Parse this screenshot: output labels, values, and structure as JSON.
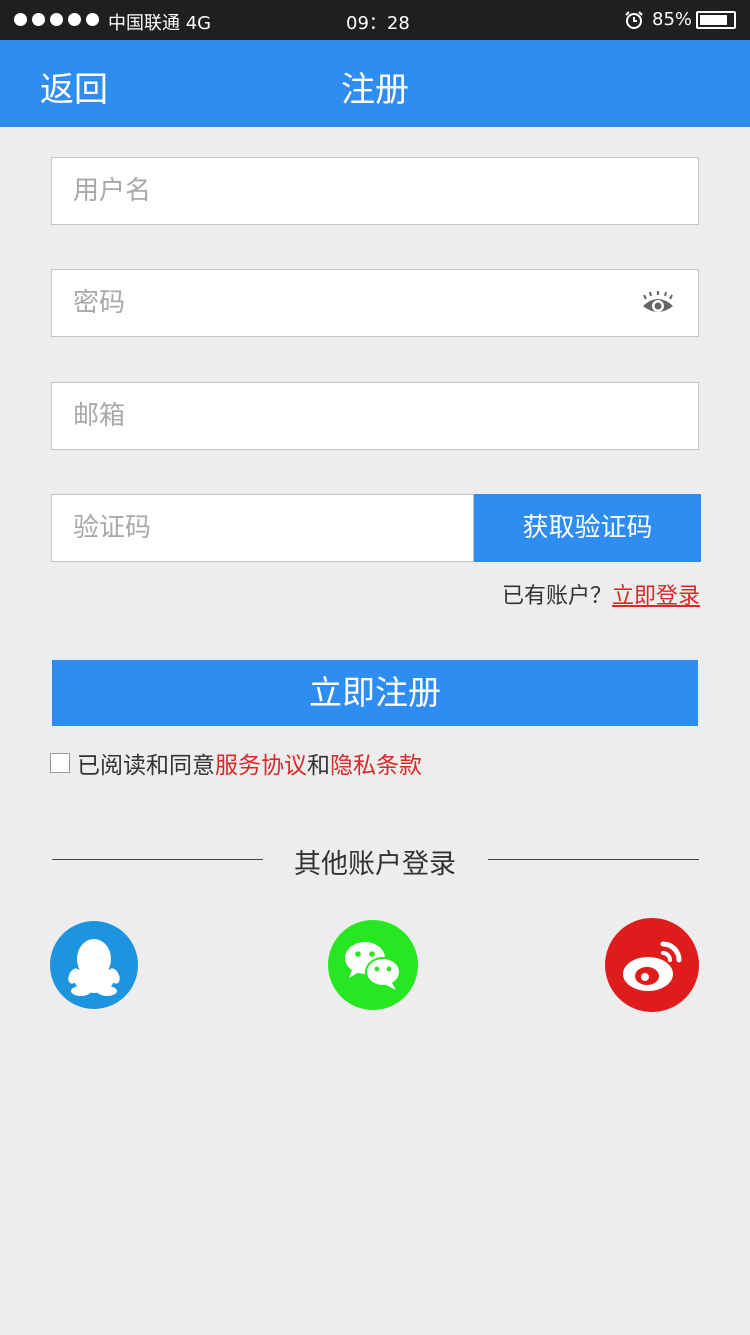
{
  "status_bar": {
    "carrier": "中国联通 4G",
    "time": "09：28",
    "battery": "85%",
    "battery_level": 0.85
  },
  "nav": {
    "back_label": "返回",
    "title": "注册"
  },
  "form": {
    "username_placeholder": "用户名",
    "password_placeholder": "密码",
    "email_placeholder": "邮箱",
    "code_placeholder": "验证码",
    "get_code_label": "获取验证码"
  },
  "login_prompt": {
    "text": "已有账户？",
    "link": "立即登录"
  },
  "register_label": "立即注册",
  "agreement": {
    "prefix": "已阅读和同意",
    "service": "服务协议",
    "and": "和",
    "privacy": "隐私条款"
  },
  "other_login": {
    "title": "其他账户登录",
    "providers": [
      "qq-icon",
      "wechat-icon",
      "weibo-icon"
    ]
  },
  "colors": {
    "primary": "#2f8cf1",
    "link_red": "#d62b2b",
    "qq": "#1d95de",
    "wechat": "#27e622",
    "weibo": "#df1c1c"
  }
}
